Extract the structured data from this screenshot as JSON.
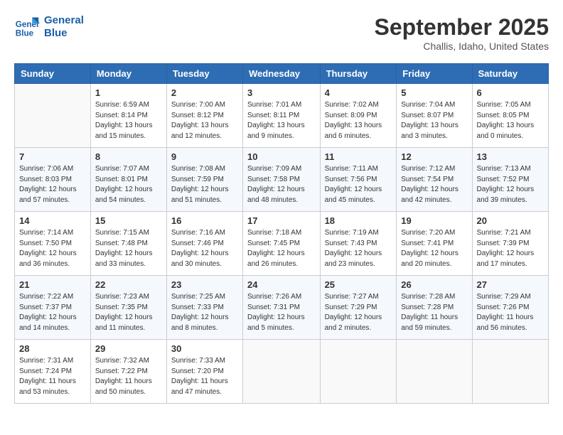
{
  "header": {
    "logo_line1": "General",
    "logo_line2": "Blue",
    "month": "September 2025",
    "location": "Challis, Idaho, United States"
  },
  "weekdays": [
    "Sunday",
    "Monday",
    "Tuesday",
    "Wednesday",
    "Thursday",
    "Friday",
    "Saturday"
  ],
  "weeks": [
    [
      {
        "day": "",
        "data": ""
      },
      {
        "day": "1",
        "data": "Sunrise: 6:59 AM\nSunset: 8:14 PM\nDaylight: 13 hours\nand 15 minutes."
      },
      {
        "day": "2",
        "data": "Sunrise: 7:00 AM\nSunset: 8:12 PM\nDaylight: 13 hours\nand 12 minutes."
      },
      {
        "day": "3",
        "data": "Sunrise: 7:01 AM\nSunset: 8:11 PM\nDaylight: 13 hours\nand 9 minutes."
      },
      {
        "day": "4",
        "data": "Sunrise: 7:02 AM\nSunset: 8:09 PM\nDaylight: 13 hours\nand 6 minutes."
      },
      {
        "day": "5",
        "data": "Sunrise: 7:04 AM\nSunset: 8:07 PM\nDaylight: 13 hours\nand 3 minutes."
      },
      {
        "day": "6",
        "data": "Sunrise: 7:05 AM\nSunset: 8:05 PM\nDaylight: 13 hours\nand 0 minutes."
      }
    ],
    [
      {
        "day": "7",
        "data": "Sunrise: 7:06 AM\nSunset: 8:03 PM\nDaylight: 12 hours\nand 57 minutes."
      },
      {
        "day": "8",
        "data": "Sunrise: 7:07 AM\nSunset: 8:01 PM\nDaylight: 12 hours\nand 54 minutes."
      },
      {
        "day": "9",
        "data": "Sunrise: 7:08 AM\nSunset: 7:59 PM\nDaylight: 12 hours\nand 51 minutes."
      },
      {
        "day": "10",
        "data": "Sunrise: 7:09 AM\nSunset: 7:58 PM\nDaylight: 12 hours\nand 48 minutes."
      },
      {
        "day": "11",
        "data": "Sunrise: 7:11 AM\nSunset: 7:56 PM\nDaylight: 12 hours\nand 45 minutes."
      },
      {
        "day": "12",
        "data": "Sunrise: 7:12 AM\nSunset: 7:54 PM\nDaylight: 12 hours\nand 42 minutes."
      },
      {
        "day": "13",
        "data": "Sunrise: 7:13 AM\nSunset: 7:52 PM\nDaylight: 12 hours\nand 39 minutes."
      }
    ],
    [
      {
        "day": "14",
        "data": "Sunrise: 7:14 AM\nSunset: 7:50 PM\nDaylight: 12 hours\nand 36 minutes."
      },
      {
        "day": "15",
        "data": "Sunrise: 7:15 AM\nSunset: 7:48 PM\nDaylight: 12 hours\nand 33 minutes."
      },
      {
        "day": "16",
        "data": "Sunrise: 7:16 AM\nSunset: 7:46 PM\nDaylight: 12 hours\nand 30 minutes."
      },
      {
        "day": "17",
        "data": "Sunrise: 7:18 AM\nSunset: 7:45 PM\nDaylight: 12 hours\nand 26 minutes."
      },
      {
        "day": "18",
        "data": "Sunrise: 7:19 AM\nSunset: 7:43 PM\nDaylight: 12 hours\nand 23 minutes."
      },
      {
        "day": "19",
        "data": "Sunrise: 7:20 AM\nSunset: 7:41 PM\nDaylight: 12 hours\nand 20 minutes."
      },
      {
        "day": "20",
        "data": "Sunrise: 7:21 AM\nSunset: 7:39 PM\nDaylight: 12 hours\nand 17 minutes."
      }
    ],
    [
      {
        "day": "21",
        "data": "Sunrise: 7:22 AM\nSunset: 7:37 PM\nDaylight: 12 hours\nand 14 minutes."
      },
      {
        "day": "22",
        "data": "Sunrise: 7:23 AM\nSunset: 7:35 PM\nDaylight: 12 hours\nand 11 minutes."
      },
      {
        "day": "23",
        "data": "Sunrise: 7:25 AM\nSunset: 7:33 PM\nDaylight: 12 hours\nand 8 minutes."
      },
      {
        "day": "24",
        "data": "Sunrise: 7:26 AM\nSunset: 7:31 PM\nDaylight: 12 hours\nand 5 minutes."
      },
      {
        "day": "25",
        "data": "Sunrise: 7:27 AM\nSunset: 7:29 PM\nDaylight: 12 hours\nand 2 minutes."
      },
      {
        "day": "26",
        "data": "Sunrise: 7:28 AM\nSunset: 7:28 PM\nDaylight: 11 hours\nand 59 minutes."
      },
      {
        "day": "27",
        "data": "Sunrise: 7:29 AM\nSunset: 7:26 PM\nDaylight: 11 hours\nand 56 minutes."
      }
    ],
    [
      {
        "day": "28",
        "data": "Sunrise: 7:31 AM\nSunset: 7:24 PM\nDaylight: 11 hours\nand 53 minutes."
      },
      {
        "day": "29",
        "data": "Sunrise: 7:32 AM\nSunset: 7:22 PM\nDaylight: 11 hours\nand 50 minutes."
      },
      {
        "day": "30",
        "data": "Sunrise: 7:33 AM\nSunset: 7:20 PM\nDaylight: 11 hours\nand 47 minutes."
      },
      {
        "day": "",
        "data": ""
      },
      {
        "day": "",
        "data": ""
      },
      {
        "day": "",
        "data": ""
      },
      {
        "day": "",
        "data": ""
      }
    ]
  ]
}
